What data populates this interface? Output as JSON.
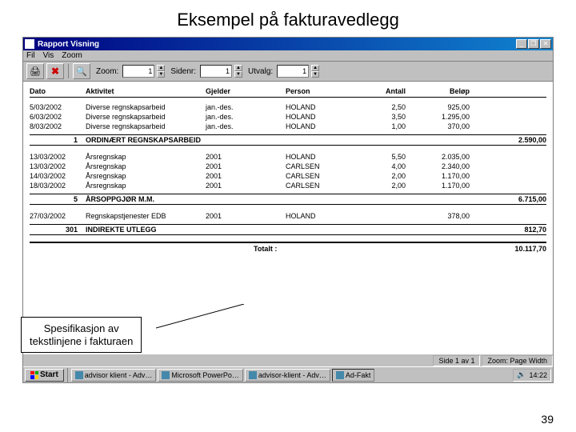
{
  "slide": {
    "title": "Eksempel på fakturavedlegg",
    "number": "39"
  },
  "callout": {
    "line1": "Spesifikasjon av",
    "line2": "tekstlinjene i fakturaen"
  },
  "window": {
    "title": "Rapport Visning",
    "menu": {
      "fil": "Fil",
      "vis": "Vis",
      "zoom": "Zoom"
    },
    "toolbar": {
      "zoom_label": "Zoom:",
      "zoom_val": "1",
      "sidenr_label": "Sidenr:",
      "sidenr_val": "1",
      "utvalg_label": "Utvalg:",
      "utvalg_val": "1"
    }
  },
  "report": {
    "headers": {
      "dato": "Dato",
      "aktivitet": "Aktivitet",
      "gjelder": "Gjelder",
      "person": "Person",
      "antall": "Antall",
      "belop": "Beløp"
    },
    "group1": {
      "rows": [
        {
          "dato": "5/03/2002",
          "akt": "Diverse regnskapsarbeid",
          "gjeld": "jan.-des.",
          "pers": "HOLAND",
          "ant": "2,50",
          "bel": "925,00"
        },
        {
          "dato": "6/03/2002",
          "akt": "Diverse regnskapsarbeid",
          "gjeld": "jan.-des.",
          "pers": "HOLAND",
          "ant": "3,50",
          "bel": "1.295,00"
        },
        {
          "dato": "8/03/2002",
          "akt": "Diverse regnskapsarbeid",
          "gjeld": "jan.-des.",
          "pers": "HOLAND",
          "ant": "1,00",
          "bel": "370,00"
        }
      ],
      "code": "1",
      "label": "ORDINÆRT REGNSKAPSARBEID",
      "sum": "2.590,00"
    },
    "group2": {
      "rows": [
        {
          "dato": "13/03/2002",
          "akt": "Årsregnskap",
          "gjeld": "2001",
          "pers": "HOLAND",
          "ant": "5,50",
          "bel": "2.035,00"
        },
        {
          "dato": "13/03/2002",
          "akt": "Årsregnskap",
          "gjeld": "2001",
          "pers": "CARLSEN",
          "ant": "4,00",
          "bel": "2.340,00"
        },
        {
          "dato": "14/03/2002",
          "akt": "Årsregnskap",
          "gjeld": "2001",
          "pers": "CARLSEN",
          "ant": "2,00",
          "bel": "1.170,00"
        },
        {
          "dato": "18/03/2002",
          "akt": "Årsregnskap",
          "gjeld": "2001",
          "pers": "CARLSEN",
          "ant": "2,00",
          "bel": "1.170,00"
        }
      ],
      "code": "5",
      "label": "ÅRSOPPGJØR M.M.",
      "sum": "6.715,00"
    },
    "group3": {
      "rows": [
        {
          "dato": "27/03/2002",
          "akt": "Regnskapstjenester EDB",
          "gjeld": "2001",
          "pers": "HOLAND",
          "ant": "",
          "bel": "378,00"
        }
      ],
      "code": "301",
      "label": "INDIREKTE UTLEGG",
      "sum": "812,70"
    },
    "total": {
      "label": "Totalt :",
      "value": "10.117,70"
    }
  },
  "status": {
    "page": "Side 1 av 1",
    "zoom": "Zoom: Page Width"
  },
  "taskbar": {
    "start": "Start",
    "tasks": [
      {
        "label": "advisor klient - Adv…"
      },
      {
        "label": "Microsoft PowerPo…"
      },
      {
        "label": "advisor-klient - Adv…"
      },
      {
        "label": "Ad-Fakt"
      }
    ],
    "clock": "14:22"
  }
}
